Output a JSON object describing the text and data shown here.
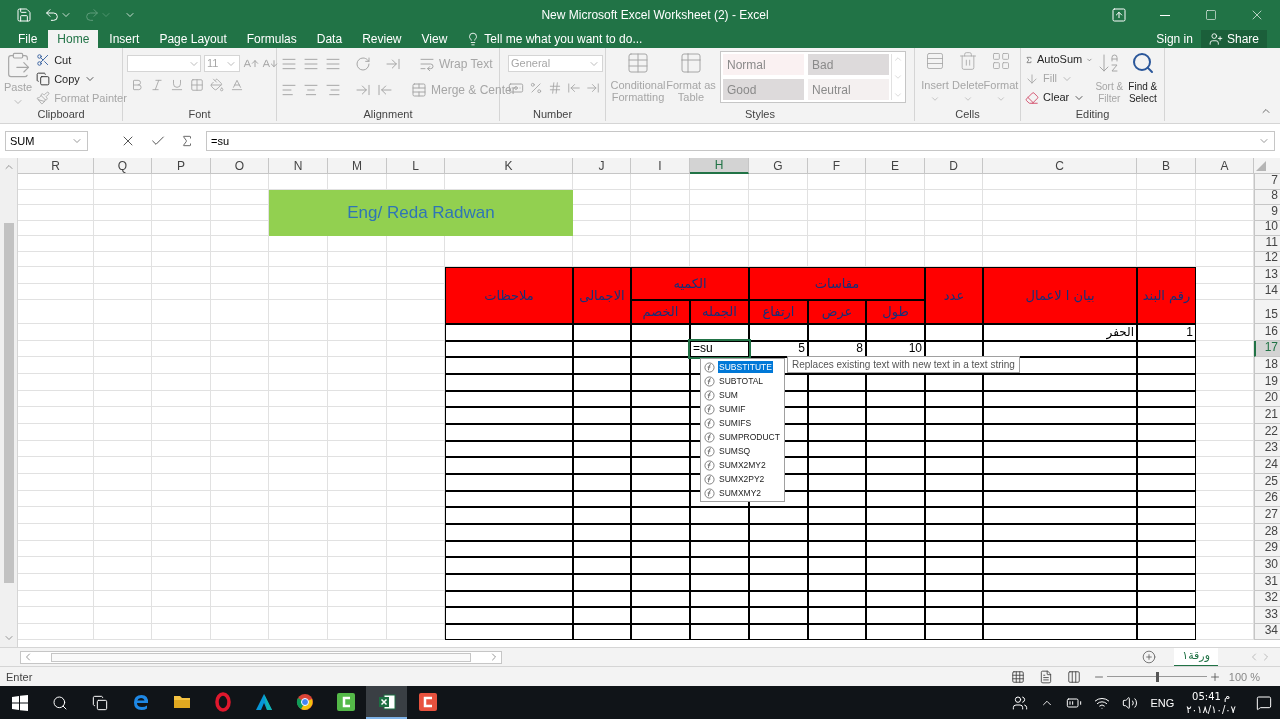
{
  "window": {
    "title": "New Microsoft Excel Worksheet (2) - Excel"
  },
  "tabs": [
    {
      "label": "File",
      "selected": false
    },
    {
      "label": "Home",
      "selected": true
    },
    {
      "label": "Insert",
      "selected": false
    },
    {
      "label": "Page Layout",
      "selected": false
    },
    {
      "label": "Formulas",
      "selected": false
    },
    {
      "label": "Data",
      "selected": false
    },
    {
      "label": "Review",
      "selected": false
    },
    {
      "label": "View",
      "selected": false
    }
  ],
  "tell_me": "Tell me what you want to do...",
  "sign_in": "Sign in",
  "share": "Share",
  "ribbon": {
    "clipboard": {
      "label": "Clipboard",
      "paste": {
        "label": "Paste",
        "disabled": true
      },
      "cut": {
        "label": "Cut",
        "disabled": false
      },
      "copy": {
        "label": "Copy",
        "disabled": false
      },
      "format_painter": {
        "label": "Format Painter",
        "disabled": true
      }
    },
    "font": {
      "label": "Font",
      "size": "11"
    },
    "alignment": {
      "label": "Alignment",
      "wrap_text": "Wrap Text",
      "merge_center": "Merge & Center"
    },
    "number": {
      "label": "Number",
      "format": "General"
    },
    "styles": {
      "label": "Styles",
      "conditional_formatting": "Conditional Formatting",
      "format_as_table": "Format as Table",
      "cells": [
        {
          "label": "Normal",
          "color": "#faf1f2"
        },
        {
          "label": "Bad",
          "color": "#dddadb"
        },
        {
          "label": "Good",
          "color": "#dddadb"
        },
        {
          "label": "Neutral",
          "color": "#f4f0f0"
        }
      ]
    },
    "cells": {
      "label": "Cells",
      "buttons": [
        "Insert",
        "Delete",
        "Format"
      ]
    },
    "editing": {
      "label": "Editing",
      "autosum": {
        "label": "AutoSum",
        "disabled": false
      },
      "fill": {
        "label": "Fill",
        "disabled": true
      },
      "clear": {
        "label": "Clear",
        "disabled": false
      },
      "sort_filter": {
        "label": "Sort & Filter",
        "disabled": true
      },
      "find_select": {
        "label": "Find & Select",
        "disabled": false
      }
    }
  },
  "formula_bar": {
    "name_box": "SUM",
    "formula": "=su"
  },
  "columns": [
    {
      "label": "R",
      "selected": false
    },
    {
      "label": "Q",
      "selected": false
    },
    {
      "label": "P",
      "selected": false
    },
    {
      "label": "O",
      "selected": false
    },
    {
      "label": "N",
      "selected": false
    },
    {
      "label": "M",
      "selected": false
    },
    {
      "label": "L",
      "selected": false
    },
    {
      "label": "K",
      "selected": false
    },
    {
      "label": "J",
      "selected": false
    },
    {
      "label": "I",
      "selected": false
    },
    {
      "label": "H",
      "selected": true
    },
    {
      "label": "G",
      "selected": false
    },
    {
      "label": "F",
      "selected": false
    },
    {
      "label": "E",
      "selected": false
    },
    {
      "label": "D",
      "selected": false
    },
    {
      "label": "C",
      "selected": false
    },
    {
      "label": "B",
      "selected": false
    },
    {
      "label": "A",
      "selected": false
    }
  ],
  "rows": [
    {
      "label": "7",
      "selected": false
    },
    {
      "label": "8",
      "selected": false
    },
    {
      "label": "9",
      "selected": false
    },
    {
      "label": "10",
      "selected": false
    },
    {
      "label": "11",
      "selected": false
    },
    {
      "label": "12",
      "selected": false
    },
    {
      "label": "13",
      "selected": false
    },
    {
      "label": "14",
      "selected": false
    },
    {
      "label": "15",
      "selected": false
    },
    {
      "label": "16",
      "selected": false
    },
    {
      "label": "17",
      "selected": true
    },
    {
      "label": "18",
      "selected": false
    },
    {
      "label": "19",
      "selected": false
    },
    {
      "label": "20",
      "selected": false
    },
    {
      "label": "21",
      "selected": false
    },
    {
      "label": "22",
      "selected": false
    },
    {
      "label": "23",
      "selected": false
    },
    {
      "label": "24",
      "selected": false
    },
    {
      "label": "25",
      "selected": false
    },
    {
      "label": "26",
      "selected": false
    },
    {
      "label": "27",
      "selected": false
    },
    {
      "label": "28",
      "selected": false
    },
    {
      "label": "29",
      "selected": false
    },
    {
      "label": "30",
      "selected": false
    },
    {
      "label": "31",
      "selected": false
    },
    {
      "label": "32",
      "selected": false
    },
    {
      "label": "33",
      "selected": false
    },
    {
      "label": "34",
      "selected": false
    }
  ],
  "banner": "Eng/ Reda Radwan",
  "table": {
    "header": [
      {
        "label": "رقم البند"
      },
      {
        "label": "بيان ا لاعمال"
      },
      {
        "label": "عدد"
      },
      {
        "label": "مقاسات",
        "children": [
          "طول",
          "عرض",
          "ارتفاع"
        ]
      },
      {
        "label": "الكميه",
        "children": [
          "الجمله",
          "الخصم"
        ]
      },
      {
        "label": "الاجمالى"
      },
      {
        "label": "ملاحظات"
      }
    ],
    "rows": [
      {
        "cells": {
          "B": {
            "text": "1",
            "active": false
          },
          "C": {
            "text": "الحفر",
            "active": false
          }
        }
      },
      {
        "cells": {
          "E": {
            "text": "10",
            "active": false
          },
          "F": {
            "text": "8",
            "active": false
          },
          "G": {
            "text": "5",
            "active": false
          },
          "H": {
            "text": "=su",
            "active": true
          }
        }
      }
    ]
  },
  "autocomplete": {
    "items": [
      {
        "label": "SUBSTITUTE",
        "selected": true
      },
      {
        "label": "SUBTOTAL",
        "selected": false
      },
      {
        "label": "SUM",
        "selected": false
      },
      {
        "label": "SUMIF",
        "selected": false
      },
      {
        "label": "SUMIFS",
        "selected": false
      },
      {
        "label": "SUMPRODUCT",
        "selected": false
      },
      {
        "label": "SUMSQ",
        "selected": false
      },
      {
        "label": "SUMX2MY2",
        "selected": false
      },
      {
        "label": "SUMX2PY2",
        "selected": false
      },
      {
        "label": "SUMXMY2",
        "selected": false
      }
    ],
    "tooltip": "Replaces existing text with new text in a text string"
  },
  "sheet_tabs": [
    {
      "label": "ورقة١",
      "selected": true
    }
  ],
  "status_bar": {
    "mode": "Enter",
    "zoom": {
      "level": 0.5,
      "reading": "100 %"
    }
  },
  "taskbar": {
    "apps": [
      {
        "kind": "browser",
        "active": false
      },
      {
        "kind": "folder",
        "active": false
      },
      {
        "kind": "ring",
        "active": false
      },
      {
        "kind": "triangle",
        "active": false
      },
      {
        "kind": "globe",
        "active": false
      },
      {
        "kind": "recorder",
        "active": false
      },
      {
        "kind": "sheet",
        "active": true
      },
      {
        "kind": "editor",
        "active": false
      }
    ],
    "language": "ENG",
    "time": "05:41 م",
    "date": "٢٠١٨/١٠/٠٧"
  }
}
